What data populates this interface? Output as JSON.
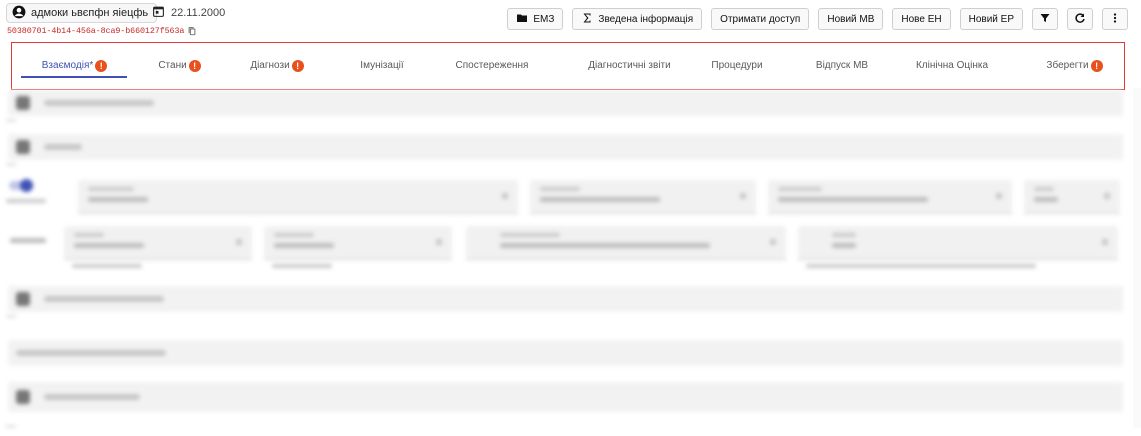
{
  "header": {
    "patient_name": "адмоки ьвєпфн яіецфь",
    "date": "22.11.2000",
    "uuid": "50380701-4b14-456a-8ca9-b660127f563a"
  },
  "toolbar": {
    "emz": "ЕМЗ",
    "summary": "Зведена інформація",
    "get_access": "Отримати доступ",
    "new_mv": "Новий МВ",
    "new_eh": "Нове ЕН",
    "new_ep": "Новий ЕР"
  },
  "tabs": [
    {
      "label": "Взаємодія*",
      "badge": "!",
      "active": true
    },
    {
      "label": "Стани",
      "badge": "!"
    },
    {
      "label": "Діагнози",
      "badge": "!"
    },
    {
      "label": "Імунізації"
    },
    {
      "label": "Спостереження"
    },
    {
      "label": "Діагностичні звіти"
    },
    {
      "label": "Процедури"
    },
    {
      "label": "Відпуск МВ"
    },
    {
      "label": "Клінічна Оцінка"
    },
    {
      "label": "Зберегти",
      "badge": "!"
    }
  ],
  "colors": {
    "accent": "#3f51b5",
    "badge": "#e8501e",
    "highlight_frame": "#e53935",
    "uuid_text": "#c62828"
  },
  "icons": [
    "account-circle-icon",
    "calendar-icon",
    "copy-icon",
    "folder-icon",
    "sigma-icon",
    "filter-icon",
    "refresh-icon",
    "more-vert-icon"
  ]
}
